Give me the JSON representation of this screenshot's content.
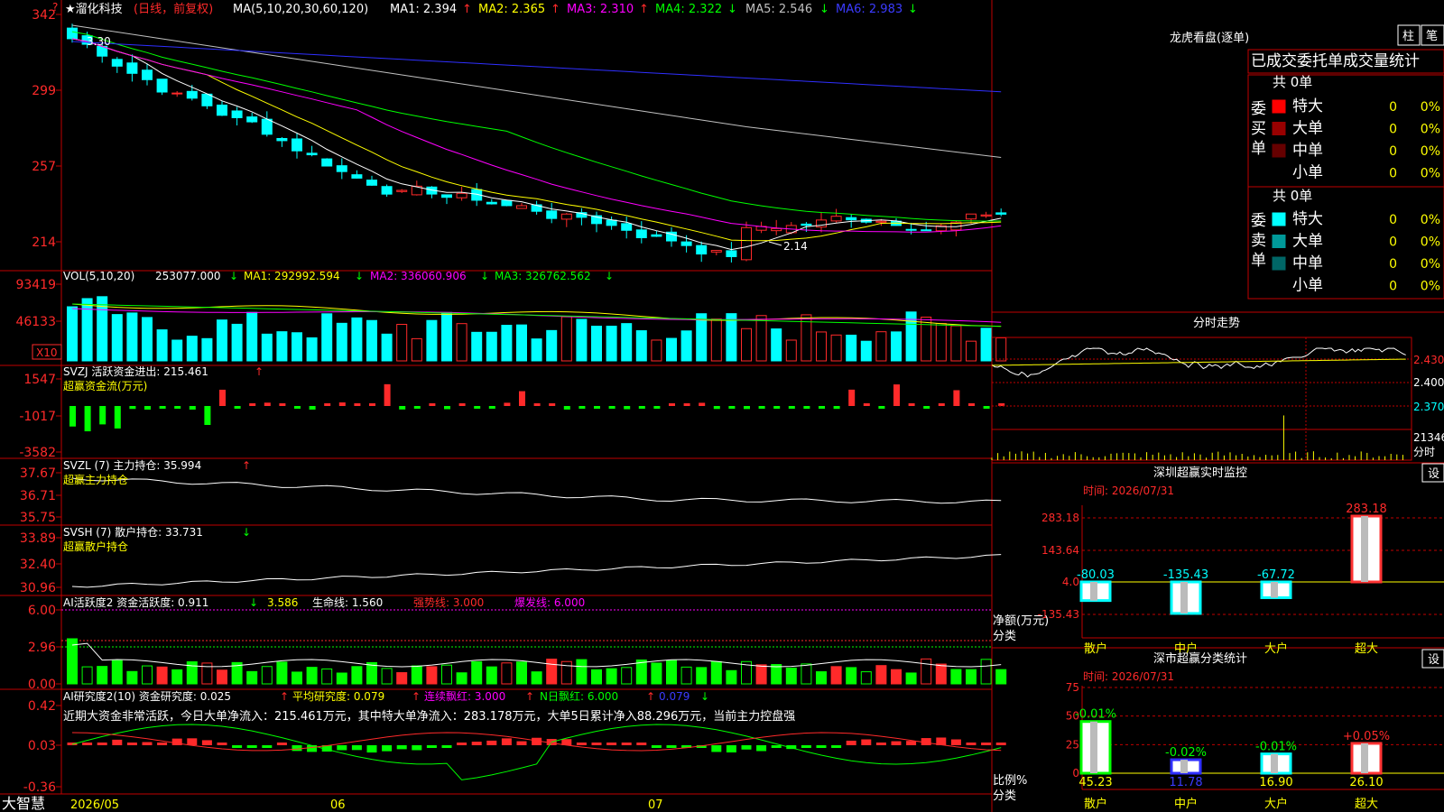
{
  "colors": {
    "up": "#ff2a2a",
    "down": "#00ffff",
    "ma1": "#ffffff",
    "ma2": "#ffff00",
    "ma3": "#ff00ff",
    "ma4": "#00ff00",
    "ma5": "#c0c0c0",
    "ma6": "#2f2fff",
    "grid": "#c00000"
  },
  "header": {
    "title": "★溜化科技",
    "period": "(日线，前复权)",
    "ma_params": "MA(5,10,20,30,60,120)",
    "ma1": "MA1: 2.394",
    "ma1_arrow": "↑",
    "ma2": "MA2: 2.365",
    "ma2_arrow": "↑",
    "ma3": "MA3: 2.310",
    "ma3_arrow": "↑",
    "ma4": "MA4: 2.322",
    "ma4_arrow": "↓",
    "ma5": "MA5: 2.546",
    "ma5_arrow": "↓",
    "ma6": "MA6: 2.983",
    "ma6_arrow": "↓",
    "help": "?"
  },
  "main_panel": {
    "y_ticks": [
      "342",
      "299",
      "257",
      "214"
    ],
    "high_label": "3.30",
    "low_label": "2.14"
  },
  "vol_panel": {
    "label": "VOL(5,10,20)",
    "value": "253077.000",
    "value_arrow": "↓",
    "ma1": "MA1: 292992.594",
    "ma1_arrow": "↓",
    "ma2": "MA2: 336060.906",
    "ma2_arrow": "↓",
    "ma3": "MA3: 326762.562",
    "ma3_arrow": "↓",
    "y_ticks": [
      "93419",
      "46133"
    ],
    "unit": "X10"
  },
  "svzj_panel": {
    "label": "SVZJ  活跃资金进出: 215.461",
    "arrow": "↑",
    "sub": "超赢资金流(万元)",
    "y_ticks": [
      "1547",
      "-1017",
      "-3582"
    ]
  },
  "svzl_panel": {
    "label": "SVZL (7) 主力持仓: 35.994",
    "arrow": "↑",
    "sub": "超赢主力持仓",
    "y_ticks": [
      "37.67",
      "36.71",
      "35.75"
    ]
  },
  "svsh_panel": {
    "label": "SVSH (7) 散户持仓: 33.731",
    "arrow": "↓",
    "sub": "超赢散户持仓",
    "y_ticks": [
      "33.89",
      "32.40",
      "30.96"
    ]
  },
  "ai_active": {
    "label": "AI活跃度2 资金活跃度: 0.911",
    "arrow": "↓",
    "v2": "3.586",
    "life": "生命线: 1.560",
    "strong": "强势线: 3.000",
    "burst": "爆发线: 6.000",
    "y_ticks": [
      "6.00",
      "2.96",
      "0.00"
    ]
  },
  "ai_research": {
    "label": "AI研究度2(10) 资金研究度: 0.025",
    "arrow": "↑",
    "avg": "平均研究度: 0.079",
    "avg_arrow": "↑",
    "cont": "连续飘红: 3.000",
    "cont_arrow": "↑",
    "nday": "N日飘红: 6.000",
    "nday_arrow": "↑",
    "last": "0.079",
    "last_arrow": "↓",
    "summary": "近期大资金非常活跃，今日大单净流入：215.461万元，其中特大单净流入：283.178万元，大单5日累计净入88.296万元，当前主力控盘强",
    "y_ticks": [
      "0.42",
      "0.03",
      "-0.36"
    ]
  },
  "x_axis": {
    "brand": "大智慧",
    "labels": [
      "2026/05",
      "06",
      "07"
    ]
  },
  "right_top": {
    "title": "龙虎看盘(逐单)",
    "btn_bar": "柱",
    "btn_pen": "笔",
    "tabs": [
      "已成交",
      "委托单",
      "成交量统计"
    ],
    "buy_label": "委买单",
    "sell_label": "委卖单",
    "buy_total": "共 0单",
    "sell_total": "共 0单",
    "buy_rows": [
      {
        "name": "特大",
        "count": "0",
        "pct": "0%",
        "color": "#ff0000"
      },
      {
        "name": "大单",
        "count": "0",
        "pct": "0%",
        "color": "#990000"
      },
      {
        "name": "中单",
        "count": "0",
        "pct": "0%",
        "color": "#660000"
      },
      {
        "name": "小单",
        "count": "0",
        "pct": "0%",
        "color": "#000000"
      }
    ],
    "sell_rows": [
      {
        "name": "特大",
        "count": "0",
        "pct": "0%",
        "color": "#00ffff"
      },
      {
        "name": "大单",
        "count": "0",
        "pct": "0%",
        "color": "#009999"
      },
      {
        "name": "中单",
        "count": "0",
        "pct": "0%",
        "color": "#006666"
      },
      {
        "name": "小单",
        "count": "0",
        "pct": "0%",
        "color": "#000000"
      }
    ]
  },
  "intraday": {
    "title": "分时走势",
    "price_ticks": [
      "2.430",
      "2.400",
      "2.370"
    ],
    "vol_tick": "21346",
    "unit": "分时"
  },
  "monitor": {
    "title": "深圳超赢实时监控",
    "setting": "设",
    "time": "时间: 2026/07/31",
    "y_ticks": [
      "283.18",
      "143.64",
      "4.0",
      "-135.43"
    ],
    "axis_label": "净额(万元)",
    "cat_label": "分类",
    "bars": [
      {
        "cat": "散户",
        "value": "-80.03",
        "num": -80.03
      },
      {
        "cat": "中户",
        "value": "-135.43",
        "num": -135.43
      },
      {
        "cat": "大户",
        "value": "-67.72",
        "num": -67.72
      },
      {
        "cat": "超大",
        "value": "283.18",
        "num": 283.18
      }
    ]
  },
  "stats": {
    "title": "深市超赢分类统计",
    "setting": "设",
    "time": "时间: 2026/07/31",
    "y_ticks": [
      "75",
      "50",
      "25",
      "0"
    ],
    "axis_label": "比例%",
    "cat_label": "分类",
    "bars": [
      {
        "cat": "散户",
        "pct": "45.23",
        "num": 45.23,
        "change": "-0.01%",
        "color": "#00ff00"
      },
      {
        "cat": "中户",
        "pct": "11.78",
        "num": 11.78,
        "change": "-0.02%",
        "color": "#2f2fff"
      },
      {
        "cat": "大户",
        "pct": "16.90",
        "num": 16.9,
        "change": "-0.01%",
        "color": "#00ffff"
      },
      {
        "cat": "超大",
        "pct": "26.10",
        "num": 26.1,
        "change": "+0.05%",
        "color": "#ff3333"
      }
    ]
  }
}
